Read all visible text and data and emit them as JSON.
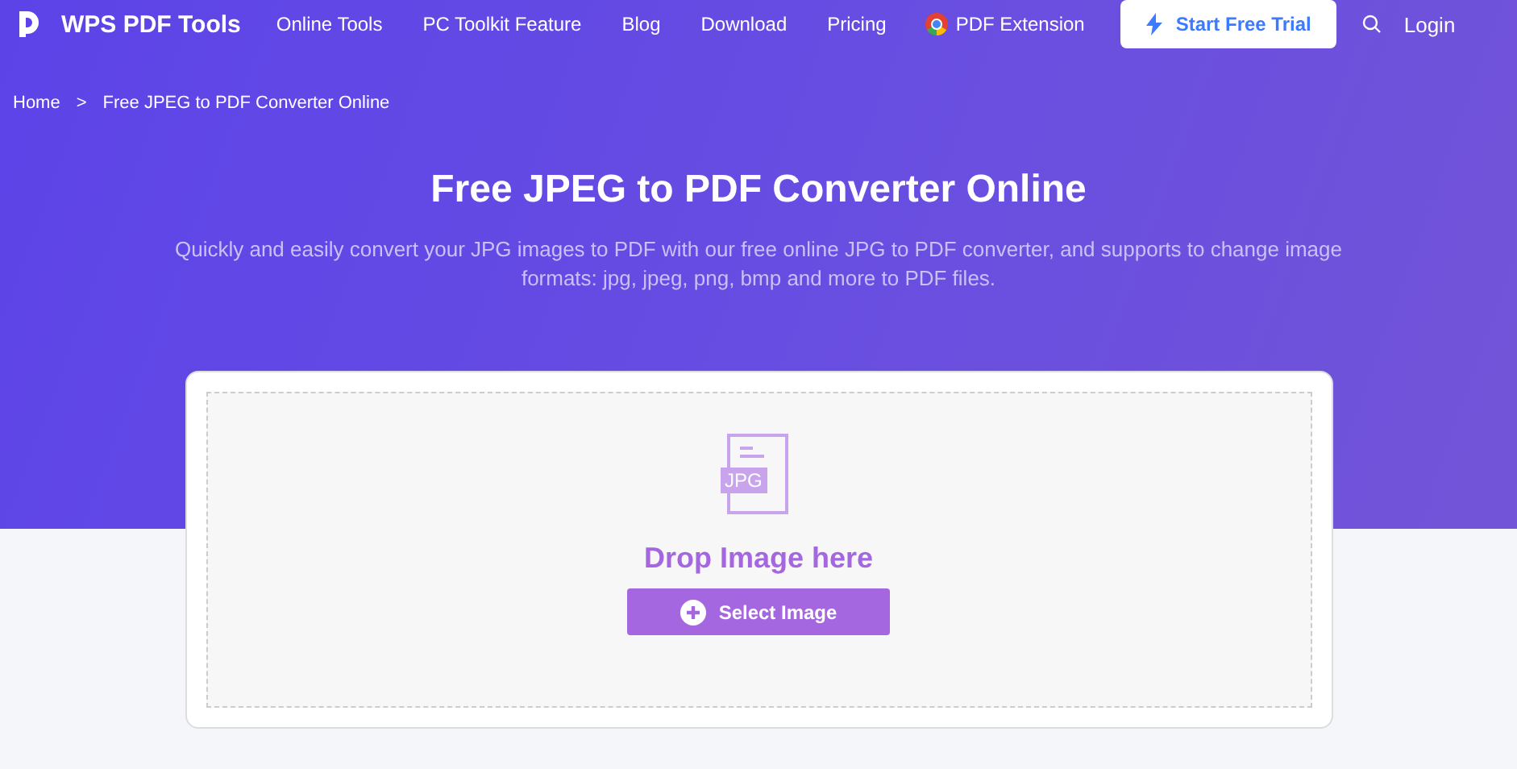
{
  "brand": "WPS PDF Tools",
  "nav": [
    {
      "label": "Online Tools",
      "kind": "link"
    },
    {
      "label": "PC Toolkit Feature",
      "kind": "link"
    },
    {
      "label": "Blog",
      "kind": "link"
    },
    {
      "label": "Download",
      "kind": "link"
    },
    {
      "label": "Pricing",
      "kind": "link"
    },
    {
      "label": "PDF Extension",
      "kind": "extension"
    }
  ],
  "trial_button": "Start Free Trial",
  "login": "Login",
  "breadcrumb": [
    "Home",
    "Free JPEG to PDF Converter Online"
  ],
  "breadcrumb_separator": ">",
  "title": "Free JPEG to PDF Converter Online",
  "subtitle": "Quickly and easily convert your JPG images to PDF with our free online JPG to PDF converter, and supports to change image formats: jpg, jpeg, png, bmp and more to PDF files.",
  "upload": {
    "file_badge": "JPG",
    "drop_text": "Drop Image here",
    "button": "Select Image"
  }
}
